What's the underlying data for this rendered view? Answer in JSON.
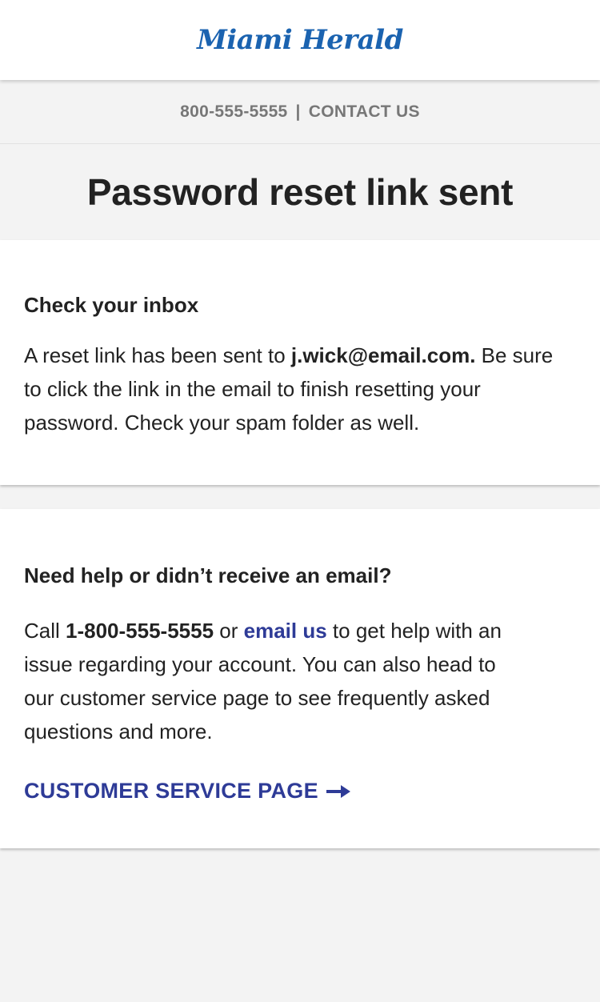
{
  "header": {
    "logo_text": "Miami Herald",
    "brand_color": "#1b63b0"
  },
  "contact_bar": {
    "phone": "800-555-5555",
    "separator": "|",
    "contact_label": "CONTACT US"
  },
  "page": {
    "title": "Password reset link sent"
  },
  "inbox_card": {
    "heading": "Check your inbox",
    "text_before": "A reset link has been sent to ",
    "email": "j.wick@email.com.",
    "text_after": " Be sure to click the link in the email to finish resetting your password. Check your spam folder as well."
  },
  "help_card": {
    "heading": "Need help or didn’t receive an email?",
    "text_call": "Call ",
    "phone": "1-800-555-5555",
    "text_or": " or ",
    "email_link_label": "email us",
    "text_rest": " to get help with an issue regarding your account. You can also head to our customer service page to see frequently asked questions and more.",
    "cta_label": "CUSTOMER SERVICE PAGE",
    "cta_icon": "arrow-right-icon",
    "link_color": "#2e3b97"
  }
}
